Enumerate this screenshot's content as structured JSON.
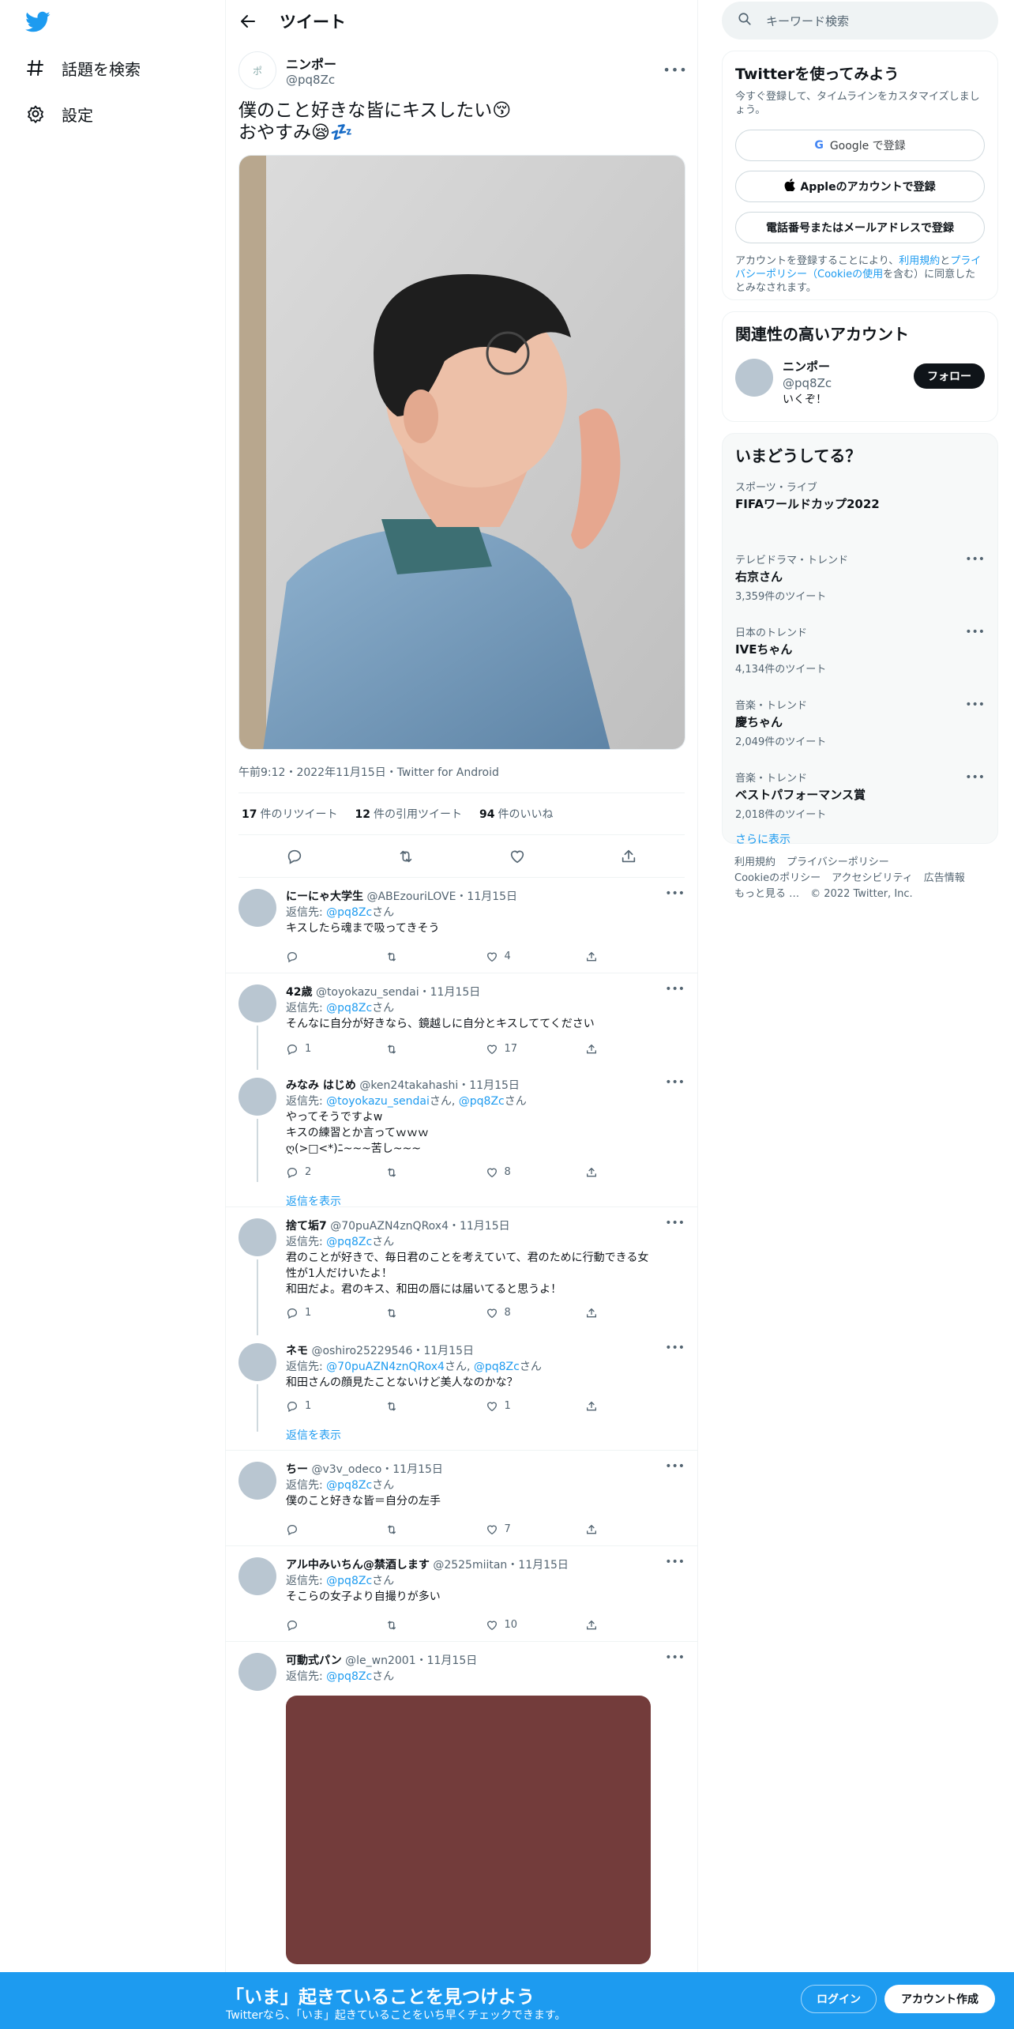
{
  "nav": {
    "explore_label": "話題を検索",
    "settings_label": "設定"
  },
  "header": {
    "title": "ツイート"
  },
  "tweet": {
    "display_name": "ニンポー",
    "handle": "@pq8Zc",
    "avatar_text": "ポ",
    "text_line1": "僕のこと好きな皆にキスしたい😚",
    "text_line2": "おやすみ😪💤",
    "meta": "午前9:12・2022年11月15日・Twitter for Android",
    "retweets_count": "17",
    "retweets_label": "件のリツイート",
    "quotes_count": "12",
    "quotes_label": "件の引用ツイート",
    "likes_count": "94",
    "likes_label": "件のいいね"
  },
  "replies": [
    {
      "name": "にーにゃ大学生",
      "handle": "@ABEzouriLOVE・11月15日",
      "replyto_prefix": "返信先: ",
      "replyto": "@pq8Zc",
      "replyto_suffix": "さん",
      "text": "キスしたら魂まで吸ってきそう",
      "replies": "",
      "retweets": "",
      "likes": "4"
    },
    {
      "name": "42歳",
      "handle": "@toyokazu_sendai・11月15日",
      "replyto_prefix": "返信先: ",
      "replyto": "@pq8Zc",
      "replyto_suffix": "さん",
      "text": "そんなに自分が好きなら、鏡越しに自分とキスしててください",
      "replies": "1",
      "retweets": "",
      "likes": "17"
    },
    {
      "name": "みなみ はじめ",
      "handle": "@ken24takahashi・11月15日",
      "replyto_prefix": "返信先: ",
      "replyto": "@toyokazu_sendai",
      "replyto_mid": "さん, ",
      "replyto2": "@pq8Zc",
      "replyto_suffix": "さん",
      "text_lines": [
        "やってそうですよw",
        "キスの練習とか言ってｗｗｗ",
        "ღ(>□<*)ﾆ~~~苦し~~~"
      ],
      "replies": "2",
      "retweets": "",
      "likes": "8"
    },
    {
      "name": "捨て垢7",
      "handle": "@70puAZN4znQRox4・11月15日",
      "replyto_prefix": "返信先: ",
      "replyto": "@pq8Zc",
      "replyto_suffix": "さん",
      "text_lines": [
        "君のことが好きで、毎日君のことを考えていて、君のために行動できる女",
        "性が1人だけいたよ！",
        "和田だよ。君のキス、和田の唇には届いてると思うよ！"
      ],
      "replies": "1",
      "retweets": "",
      "likes": "8"
    },
    {
      "name": "ネモ",
      "handle": "@oshiro25229546・11月15日",
      "replyto_prefix": "返信先: ",
      "replyto": "@70puAZN4znQRox4",
      "replyto_mid": "さん, ",
      "replyto2": "@pq8Zc",
      "replyto_suffix": "さん",
      "text": "和田さんの顔見たことないけど美人なのかな？",
      "replies": "1",
      "retweets": "",
      "likes": "1"
    },
    {
      "name": "ちー",
      "handle": "@v3v_odeco・11月15日",
      "replyto_prefix": "返信先: ",
      "replyto": "@pq8Zc",
      "replyto_suffix": "さん",
      "text": "僕のこと好きな皆＝自分の左手",
      "replies": "",
      "retweets": "",
      "likes": "7"
    },
    {
      "name": "アル中みいちん@禁酒します",
      "handle": "@2525miitan・11月15日",
      "replyto_prefix": "返信先: ",
      "replyto": "@pq8Zc",
      "replyto_suffix": "さん",
      "text": "そこらの女子より自撮りが多い",
      "replies": "",
      "retweets": "",
      "likes": "10"
    },
    {
      "name": "可動式パン",
      "handle": "@le_wn2001・11月15日",
      "replyto_prefix": "返信先: ",
      "replyto": "@pq8Zc",
      "replyto_suffix": "さん"
    }
  ],
  "show_replies_label": "返信を表示",
  "sidebar": {
    "search_placeholder": "キーワード検索",
    "signup_title": "Twitterを使ってみよう",
    "signup_sub": "今すぐ登録して、タイムラインをカスタマイズしましょう。",
    "google_btn": "Google で登録",
    "apple_btn": "Appleのアカウントで登録",
    "phone_btn": "電話番号またはメールアドレスで登録",
    "terms_pre": "アカウントを登録することにより、",
    "terms_link1": "利用規約",
    "terms_mid": "と",
    "terms_link2": "プライバシーポリシー（Cookieの使用",
    "terms_post": "を含む）に同意したとみなされます。",
    "related_title": "関連性の高いアカウント",
    "related_name": "ニンポー",
    "related_handle": "@pq8Zc",
    "related_bio": "いくぞ！",
    "follow_label": "フォロー",
    "trends_title": "いまどうしてる？",
    "trends": [
      {
        "category": "スポーツ・ライブ",
        "name": "FIFAワールドカップ2022",
        "count": ""
      },
      {
        "category": "テレビドラマ・トレンド",
        "name": "右京さん",
        "count": "3,359件のツイート"
      },
      {
        "category": "日本のトレンド",
        "name": "IVEちゃん",
        "count": "4,134件のツイート"
      },
      {
        "category": "音楽・トレンド",
        "name": "慶ちゃん",
        "count": "2,049件のツイート"
      },
      {
        "category": "音楽・トレンド",
        "name": "ベストパフォーマンス賞",
        "count": "2,018件のツイート"
      }
    ],
    "show_more": "さらに表示",
    "footer": [
      "利用規約",
      "プライバシーポリシー",
      "Cookieのポリシー",
      "アクセシビリティ",
      "広告情報",
      "もっと見る …",
      "© 2022 Twitter, Inc."
    ]
  },
  "bottombar": {
    "title": "「いま」起きていることを見つけよう",
    "subtitle": "Twitterなら、「いま」起きていることをいち早くチェックできます。",
    "login": "ログイン",
    "signup": "アカウント作成"
  },
  "colors": {
    "accent": "#1d9bf0",
    "text": "#0f1419",
    "muted": "#536471"
  }
}
